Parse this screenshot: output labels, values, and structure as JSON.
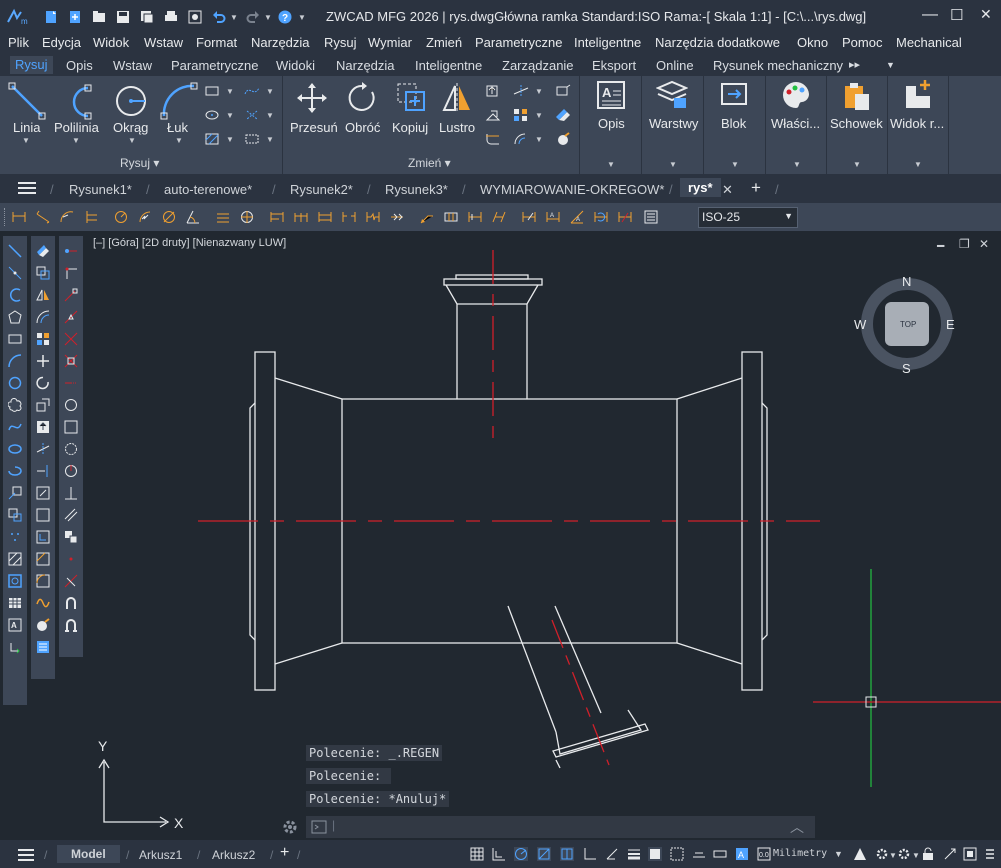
{
  "window": {
    "title": "ZWCAD MFG 2026 | rys.dwgGłówna ramka  Standard:ISO Rama:-[ Skala 1:1] - [C:\\...\\rys.dwg]",
    "minimize": "—",
    "maximize": "☐",
    "close": "✕"
  },
  "menubar": [
    "Plik",
    "Edycja",
    "Widok",
    "Wstaw",
    "Format",
    "Narzędzia",
    "Rysuj",
    "Wymiar",
    "Zmień",
    "Parametryczne",
    "Inteligentne",
    "Narzędzia dodatkowe",
    "Okno",
    "Pomoc",
    "Mechanical"
  ],
  "ribbon_tabs": [
    "Rysuj",
    "Opis",
    "Wstaw",
    "Parametryczne",
    "Widoki",
    "Narzędzia",
    "Inteligentne",
    "Zarządzanie",
    "Eksport",
    "Online",
    "Rysunek mechaniczny"
  ],
  "ribbon": {
    "draw": {
      "linia": "Linia",
      "polilinia": "Polilinia",
      "okrag": "Okrąg",
      "luk": "Łuk",
      "panel": "Rysuj ▾"
    },
    "modify": {
      "przesun": "Przesuń",
      "obroc": "Obróć",
      "kopiuj": "Kopiuj",
      "lustro": "Lustro",
      "panel": "Zmień ▾"
    },
    "right": {
      "opis": "Opis",
      "warstwy": "Warstwy",
      "blok": "Blok",
      "wlasc": "Właści...",
      "schowek": "Schowek",
      "widok": "Widok r..."
    }
  },
  "doc_tabs": [
    "Rysunek1*",
    "auto-terenowe*",
    "Rysunek2*",
    "Rysunek3*",
    "WYMIAROWANIE-OKREGOW*",
    "rys*"
  ],
  "dim_style": "ISO-25",
  "viewport": {
    "label": "[–] [Góra] [2D druty] [Nienazwany LUW]"
  },
  "viewcube": {
    "n": "N",
    "s": "S",
    "e": "E",
    "w": "W",
    "top": "TOP"
  },
  "ucs": {
    "x": "X",
    "y": "Y"
  },
  "command_history": [
    "Polecenie: _.REGEN",
    "Polecenie: ",
    "Polecenie: *Anuluj*"
  ],
  "layout_tabs": {
    "model": "Model",
    "a1": "Arkusz1",
    "a2": "Arkusz2",
    "add": "+"
  },
  "status": {
    "units": "Milimetry"
  },
  "colors": {
    "centerline": "#d0202a",
    "geometry": "#e8eaec",
    "accent": "#4fa3ff",
    "ucs_green": "#22c040"
  }
}
